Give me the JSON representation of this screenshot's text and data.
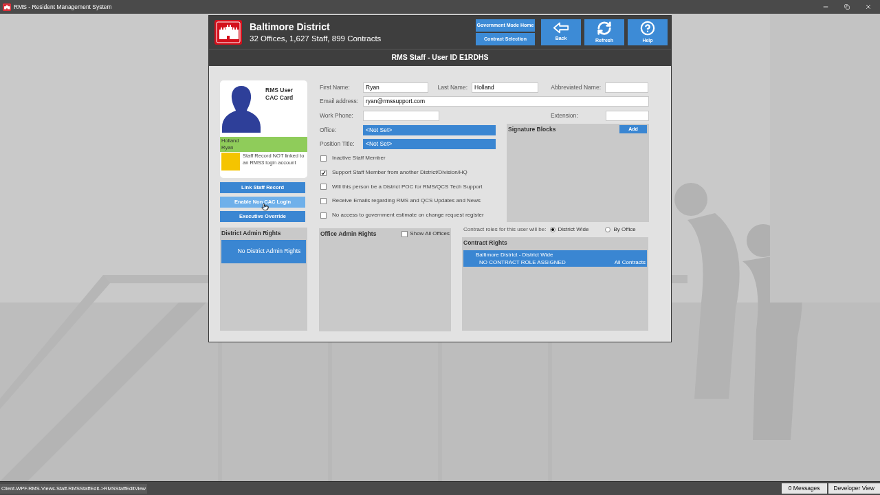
{
  "window": {
    "title": "RMS - Resident Management System"
  },
  "header": {
    "district": "Baltimore District",
    "summary": "32 Offices, 1,627 Staff, 899 Contracts",
    "nav_buttons": [
      "Government Mode Home",
      "Contract Selection"
    ],
    "tool_buttons": [
      {
        "label": "Back",
        "kind": "back"
      },
      {
        "label": "Refresh",
        "kind": "refresh"
      },
      {
        "label": "Help",
        "kind": "help"
      }
    ]
  },
  "page_title": "RMS Staff - User ID E1RDHS",
  "card": {
    "title_lines": [
      "RMS User",
      "CAC Card"
    ],
    "last_name": "Holland",
    "first_name": "Ryan",
    "status": "Staff Record NOT linked to an RMS3 login account"
  },
  "actions": [
    {
      "label": "Link Staff Record",
      "hovered": false
    },
    {
      "label": "Enable Non CAC Login",
      "hovered": true
    },
    {
      "label": "Executive Override",
      "hovered": false
    }
  ],
  "fields": {
    "first_name": {
      "label": "First Name:",
      "value": "Ryan"
    },
    "last_name": {
      "label": "Last Name:",
      "value": "Holland"
    },
    "abbreviated_name": {
      "label": "Abbreviated Name:"
    },
    "email": {
      "label": "Email address:",
      "value": "ryan@rmssupport.com"
    },
    "work_phone": {
      "label": "Work Phone:"
    },
    "extension": {
      "label": "Extension:"
    },
    "office": {
      "label": "Office:",
      "value": "<Not Set>"
    },
    "position_title": {
      "label": "Position Title:",
      "value": "<Not Set>"
    }
  },
  "checkboxes": [
    {
      "label": "Inactive Staff Member",
      "checked": false
    },
    {
      "label": "Support Staff Member from another District/Division/HQ",
      "checked": true
    },
    {
      "label": "Will this person be a District POC for RMS/QCS Tech Support",
      "checked": false
    },
    {
      "label": "Receive Emails regarding RMS and QCS Updates and News",
      "checked": false
    },
    {
      "label": "No access to government estimate on change request register",
      "checked": false
    }
  ],
  "signature_blocks": {
    "title": "Signature Blocks",
    "add_button": "Add"
  },
  "district_admin": {
    "title": "District Admin Rights",
    "item": "No District Admin Rights"
  },
  "office_admin": {
    "title": "Office Admin Rights",
    "show_all": {
      "label": "Show All Offices",
      "checked": false
    }
  },
  "contract_scope": {
    "label": "Contract roles for this user will be:",
    "options": [
      {
        "label": "District Wide",
        "selected": true
      },
      {
        "label": "By Office",
        "selected": false
      }
    ]
  },
  "contract_rights": {
    "title": "Contract Rights",
    "rows": [
      {
        "name": "Baltimore District - District Wide",
        "role": "NO CONTRACT ROLE ASSIGNED",
        "scope": "All Contracts"
      }
    ]
  },
  "status_bar": {
    "path": "Client.WPF.RMS.Views.Staff.RMSStaffEdit->RMSStaffEditView",
    "messages": "0 Messages",
    "view": "Developer View"
  }
}
